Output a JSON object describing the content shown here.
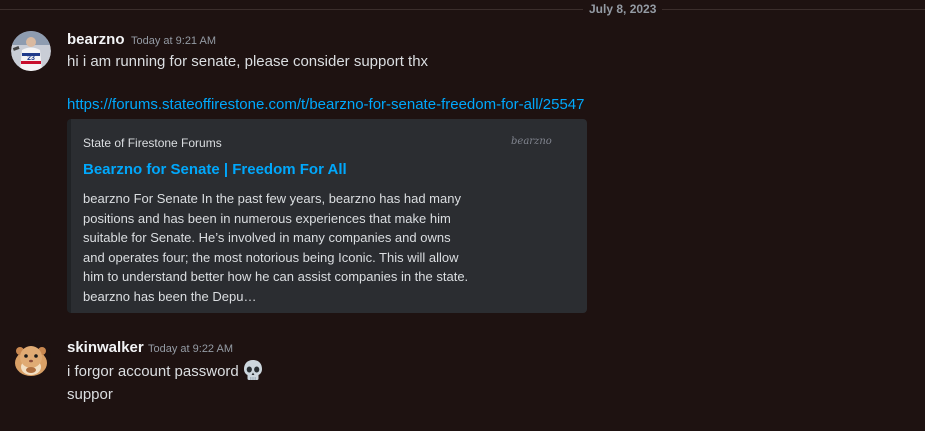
{
  "date_divider": "July 8, 2023",
  "messages": [
    {
      "username": "bearzno",
      "timestamp": "Today at 9:21 AM",
      "avatar": "hockey-player-avatar",
      "text": "hi i am running for senate, please consider support thx",
      "link": "https://forums.stateoffirestone.com/t/bearzno-for-senate-freedom-for-all/25547",
      "embed": {
        "provider": "State of Firestone Forums",
        "title": "Bearzno for Senate | Freedom For All",
        "description": "bearzno For Senate In the past few years, bearzno has had many positions and has been in numerous experiences that make him suitable for Senate. He’s involved in many companies and owns and operates four; the most notorious being Iconic. This will allow him to understand better how he can assist companies in the state. bearzno has been the Depu…",
        "thumbnail_text": "bearzno"
      }
    },
    {
      "username": "skinwalker",
      "timestamp": "Today at 9:22 AM",
      "avatar": "hamster-avatar",
      "lines": [
        "i forgor account password",
        "suppor"
      ],
      "emoji": "skull-emoji"
    }
  ],
  "colors": {
    "background": "#1e1211",
    "link": "#00a8fc",
    "embed_background": "#2b2d31"
  }
}
